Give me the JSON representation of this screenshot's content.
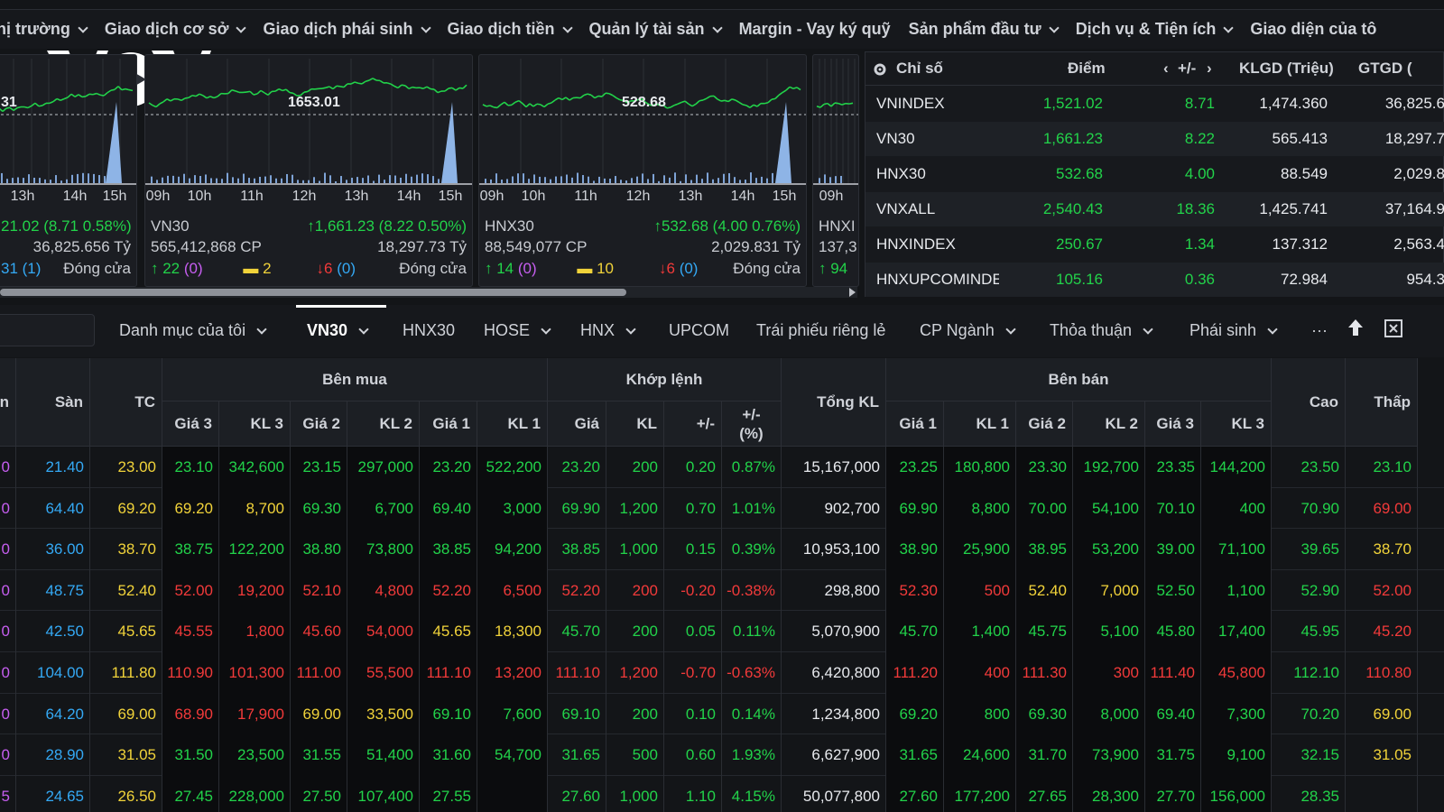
{
  "top_menu": [
    {
      "label": "hị trường",
      "has_dropdown": true
    },
    {
      "label": "Giao dịch cơ sở",
      "has_dropdown": true
    },
    {
      "label": "Giao dịch phái sinh",
      "has_dropdown": true
    },
    {
      "label": "Giao dịch tiền",
      "has_dropdown": true
    },
    {
      "label": "Quản lý tài sản",
      "has_dropdown": true
    },
    {
      "label": "Margin - Vay ký quỹ",
      "has_dropdown": false
    },
    {
      "label": "Sản phẩm đầu tư",
      "has_dropdown": true
    },
    {
      "label": "Dịch vụ & Tiện ích",
      "has_dropdown": true
    },
    {
      "label": "Giao diện của tô",
      "has_dropdown": false
    }
  ],
  "logo": {
    "text": "VOV"
  },
  "mini_charts": [
    {
      "ref_label": "31",
      "ticks": [
        "13h",
        "14h",
        "15h"
      ],
      "index_change": "21.02 (8.71 0.58%)",
      "name": "",
      "volume": "",
      "value": "36,825.656 Tỷ",
      "up": "",
      "up_ceiling": "",
      "unchanged": "",
      "down": "",
      "down_floor": "31 (1)",
      "status": "Đóng cửa"
    },
    {
      "ref_label": "1653.01",
      "ticks": [
        "09h",
        "10h",
        "11h",
        "12h",
        "13h",
        "14h",
        "15h"
      ],
      "index_change": "1,661.23 (8.22 0.50%)",
      "name": "VN30",
      "volume": "565,412,868 CP",
      "value": "18,297.73 Tỷ",
      "up": "22",
      "up_ceiling": "(0)",
      "unchanged": "2",
      "down": "6",
      "down_floor": "(0)",
      "status": "Đóng cửa"
    },
    {
      "ref_label": "528.68",
      "ticks": [
        "09h",
        "10h",
        "11h",
        "12h",
        "13h",
        "14h",
        "15h"
      ],
      "index_change": "532.68 (4.00 0.76%)",
      "name": "HNX30",
      "volume": "88,549,077 CP",
      "value": "2,029.831 Tỷ",
      "up": "14",
      "up_ceiling": "(0)",
      "unchanged": "10",
      "down": "6",
      "down_floor": "(0)",
      "status": "Đóng cửa"
    },
    {
      "ref_label": "",
      "ticks": [
        "09h"
      ],
      "index_change": "",
      "name": "HNXI",
      "volume": "137,3",
      "value": "",
      "up": "94"
    }
  ],
  "index_table": {
    "headers": {
      "name": "Chỉ số",
      "point": "Điểm",
      "change": "+/-",
      "volume": "KLGD (Triệu)",
      "value": "GTGD ("
    },
    "rows": [
      {
        "name": "VNINDEX",
        "point": "1,521.02",
        "change": "8.71",
        "volume": "1,474.360",
        "value": "36,825.6"
      },
      {
        "name": "VN30",
        "point": "1,661.23",
        "change": "8.22",
        "volume": "565.413",
        "value": "18,297.7"
      },
      {
        "name": "HNX30",
        "point": "532.68",
        "change": "4.00",
        "volume": "88.549",
        "value": "2,029.8"
      },
      {
        "name": "VNXALL",
        "point": "2,540.43",
        "change": "18.36",
        "volume": "1,425.741",
        "value": "37,164.9"
      },
      {
        "name": "HNXINDEX",
        "point": "250.67",
        "change": "1.34",
        "volume": "137.312",
        "value": "2,563.4"
      },
      {
        "name": "HNXUPCOMINDE",
        "point": "105.16",
        "change": "0.36",
        "volume": "72.984",
        "value": "954.3"
      }
    ]
  },
  "tabs": [
    {
      "label": "Danh mục của tôi",
      "dropdown": true,
      "active": false
    },
    {
      "label": "VN30",
      "dropdown": true,
      "active": true
    },
    {
      "label": "HNX30",
      "dropdown": false,
      "active": false
    },
    {
      "label": "HOSE",
      "dropdown": true,
      "active": false
    },
    {
      "label": "HNX",
      "dropdown": true,
      "active": false
    },
    {
      "label": "UPCOM",
      "dropdown": false,
      "active": false
    },
    {
      "label": "Trái phiếu riêng lẻ",
      "dropdown": false,
      "active": false
    },
    {
      "label": "CP Ngành",
      "dropdown": true,
      "active": false
    },
    {
      "label": "Thỏa thuận",
      "dropdown": true,
      "active": false
    },
    {
      "label": "Phái sinh",
      "dropdown": true,
      "active": false
    },
    {
      "label": "···",
      "dropdown": false,
      "active": false
    }
  ],
  "board": {
    "group_headers": {
      "bid": "Bên mua",
      "match": "Khớp lệnh",
      "ask": "Bên bán"
    },
    "headers": {
      "ceil": "n",
      "floor": "Sàn",
      "ref": "TC",
      "b3p": "Giá 3",
      "b3v": "KL 3",
      "b2p": "Giá 2",
      "b2v": "KL 2",
      "b1p": "Giá 1",
      "b1v": "KL 1",
      "mp": "Giá",
      "mv": "KL",
      "chg": "+/-",
      "pct": "+/-\n(%)",
      "total": "Tổng KL",
      "a1p": "Giá 1",
      "a1v": "KL 1",
      "a2p": "Giá 2",
      "a2v": "KL 2",
      "a3p": "Giá 3",
      "a3v": "KL 3",
      "high": "Cao",
      "low": "Thấp"
    },
    "colors": {
      "up": "#22d34a",
      "down": "#f23a3a",
      "ref": "#f1d33a",
      "ceil": "#c65ef0",
      "floor": "#34a9f5"
    },
    "rows": [
      {
        "ceil": "0",
        "floor": "21.40",
        "ref": "23.00",
        "b3p": "23.10",
        "b3v": "342,600",
        "b2p": "23.15",
        "b2v": "297,000",
        "b1p": "23.20",
        "b1v": "522,200",
        "mp": "23.20",
        "mv": "200",
        "chg": "0.20",
        "pct": "0.87%",
        "total": "15,167,000",
        "a1p": "23.25",
        "a1v": "180,800",
        "a2p": "23.30",
        "a2v": "192,700",
        "a3p": "23.35",
        "a3v": "144,200",
        "high": "23.50",
        "low": "23.10"
      },
      {
        "ceil": "0",
        "floor": "64.40",
        "ref": "69.20",
        "b3p": "69.20",
        "b3v": "8,700",
        "b2p": "69.30",
        "b2v": "6,700",
        "b1p": "69.40",
        "b1v": "3,000",
        "mp": "69.90",
        "mv": "1,200",
        "chg": "0.70",
        "pct": "1.01%",
        "total": "902,700",
        "a1p": "69.90",
        "a1v": "8,800",
        "a2p": "70.00",
        "a2v": "54,100",
        "a3p": "70.10",
        "a3v": "400",
        "high": "70.90",
        "low": "69.00"
      },
      {
        "ceil": "0",
        "floor": "36.00",
        "ref": "38.70",
        "b3p": "38.75",
        "b3v": "122,200",
        "b2p": "38.80",
        "b2v": "73,800",
        "b1p": "38.85",
        "b1v": "94,200",
        "mp": "38.85",
        "mv": "1,000",
        "chg": "0.15",
        "pct": "0.39%",
        "total": "10,953,100",
        "a1p": "38.90",
        "a1v": "25,900",
        "a2p": "38.95",
        "a2v": "53,200",
        "a3p": "39.00",
        "a3v": "71,100",
        "high": "39.65",
        "low": "38.70"
      },
      {
        "ceil": "0",
        "floor": "48.75",
        "ref": "52.40",
        "b3p": "52.00",
        "b3v": "19,200",
        "b2p": "52.10",
        "b2v": "4,800",
        "b1p": "52.20",
        "b1v": "6,500",
        "mp": "52.20",
        "mv": "200",
        "chg": "-0.20",
        "pct": "-0.38%",
        "total": "298,800",
        "a1p": "52.30",
        "a1v": "500",
        "a2p": "52.40",
        "a2v": "7,000",
        "a3p": "52.50",
        "a3v": "1,100",
        "high": "52.90",
        "low": "52.00"
      },
      {
        "ceil": "0",
        "floor": "42.50",
        "ref": "45.65",
        "b3p": "45.55",
        "b3v": "1,800",
        "b2p": "45.60",
        "b2v": "54,000",
        "b1p": "45.65",
        "b1v": "18,300",
        "mp": "45.70",
        "mv": "200",
        "chg": "0.05",
        "pct": "0.11%",
        "total": "5,070,900",
        "a1p": "45.70",
        "a1v": "1,400",
        "a2p": "45.75",
        "a2v": "5,100",
        "a3p": "45.80",
        "a3v": "17,400",
        "high": "45.95",
        "low": "45.20"
      },
      {
        "ceil": "0",
        "floor": "104.00",
        "ref": "111.80",
        "b3p": "110.90",
        "b3v": "101,300",
        "b2p": "111.00",
        "b2v": "55,500",
        "b1p": "111.10",
        "b1v": "13,200",
        "mp": "111.10",
        "mv": "1,200",
        "chg": "-0.70",
        "pct": "-0.63%",
        "total": "6,420,800",
        "a1p": "111.20",
        "a1v": "400",
        "a2p": "111.30",
        "a2v": "300",
        "a3p": "111.40",
        "a3v": "45,800",
        "high": "112.10",
        "low": "110.80"
      },
      {
        "ceil": "0",
        "floor": "64.20",
        "ref": "69.00",
        "b3p": "68.90",
        "b3v": "17,900",
        "b2p": "69.00",
        "b2v": "33,500",
        "b1p": "69.10",
        "b1v": "7,600",
        "mp": "69.10",
        "mv": "200",
        "chg": "0.10",
        "pct": "0.14%",
        "total": "1,234,800",
        "a1p": "69.20",
        "a1v": "800",
        "a2p": "69.30",
        "a2v": "8,000",
        "a3p": "69.40",
        "a3v": "7,300",
        "high": "70.20",
        "low": "69.00"
      },
      {
        "ceil": "0",
        "floor": "28.90",
        "ref": "31.05",
        "b3p": "31.50",
        "b3v": "23,500",
        "b2p": "31.55",
        "b2v": "51,400",
        "b1p": "31.60",
        "b1v": "54,700",
        "mp": "31.65",
        "mv": "500",
        "chg": "0.60",
        "pct": "1.93%",
        "total": "6,627,900",
        "a1p": "31.65",
        "a1v": "24,600",
        "a2p": "31.70",
        "a2v": "73,900",
        "a3p": "31.75",
        "a3v": "9,100",
        "high": "32.15",
        "low": "31.05"
      },
      {
        "ceil": "5",
        "floor": "24.65",
        "ref": "26.50",
        "b3p": "27.45",
        "b3v": "228,000",
        "b2p": "27.50",
        "b2v": "107,400",
        "b1p": "27.55",
        "b1v": "",
        "mp": "27.60",
        "mv": "1,000",
        "chg": "1.10",
        "pct": "4.15%",
        "total": "50,077,800",
        "a1p": "27.60",
        "a1v": "177,200",
        "a2p": "27.65",
        "a2v": "28,300",
        "a3p": "27.70",
        "a3v": "156,000",
        "high": "28.35",
        "low": ""
      }
    ]
  }
}
